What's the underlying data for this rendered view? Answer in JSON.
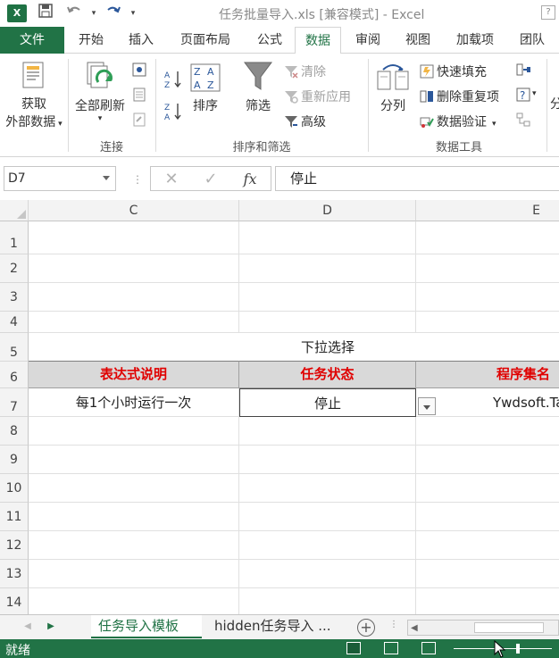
{
  "window": {
    "logo": "X",
    "title": "任务批量导入.xls  [兼容模式] - Excel",
    "help": "?"
  },
  "qat": {
    "save_icon": "save-icon",
    "undo_icon": "undo-icon",
    "redo_icon": "redo-icon"
  },
  "ribbon_tabs": [
    "文件",
    "开始",
    "插入",
    "页面布局",
    "公式",
    "数据",
    "审阅",
    "视图",
    "加载项",
    "团队"
  ],
  "active_tab": "数据",
  "ribbon": {
    "get_external_data": [
      "获取",
      "外部数据"
    ],
    "refresh_all": "全部刷新",
    "group_connections": "连接",
    "sort": "排序",
    "filter": "筛选",
    "clear": "清除",
    "reapply": "重新应用",
    "advanced": "高级",
    "group_sort_filter": "排序和筛选",
    "text_to_columns": "分列",
    "flash_fill": "快速填充",
    "remove_duplicates": "删除重复项",
    "data_validation": "数据验证",
    "group_data_tools": "数据工具",
    "overflow_label": "分"
  },
  "formula_bar": {
    "name_box": "D7",
    "cancel": "✕",
    "enter": "✓",
    "fx": "fx",
    "value": "停止"
  },
  "columns": [
    "C",
    "D",
    "E"
  ],
  "rows": [
    "1",
    "2",
    "3",
    "4",
    "5",
    "6",
    "7",
    "8",
    "9",
    "10",
    "11",
    "12",
    "13",
    "14"
  ],
  "cells": {
    "D5": "下拉选择",
    "C6": "表达式说明",
    "D6": "任务状态",
    "E6": "程序集名",
    "C7": "每1个小时运行一次",
    "D7": "停止",
    "E7": "Ywdsoft.Ta"
  },
  "sheets": [
    "任务导入模板",
    "hidden任务导入 ..."
  ],
  "active_sheet": "任务导入模板",
  "status": {
    "ready": "就绪"
  },
  "colors": {
    "excel_green": "#217346",
    "header_text_red": "#e00000",
    "header_fill": "#d9d9d9"
  }
}
